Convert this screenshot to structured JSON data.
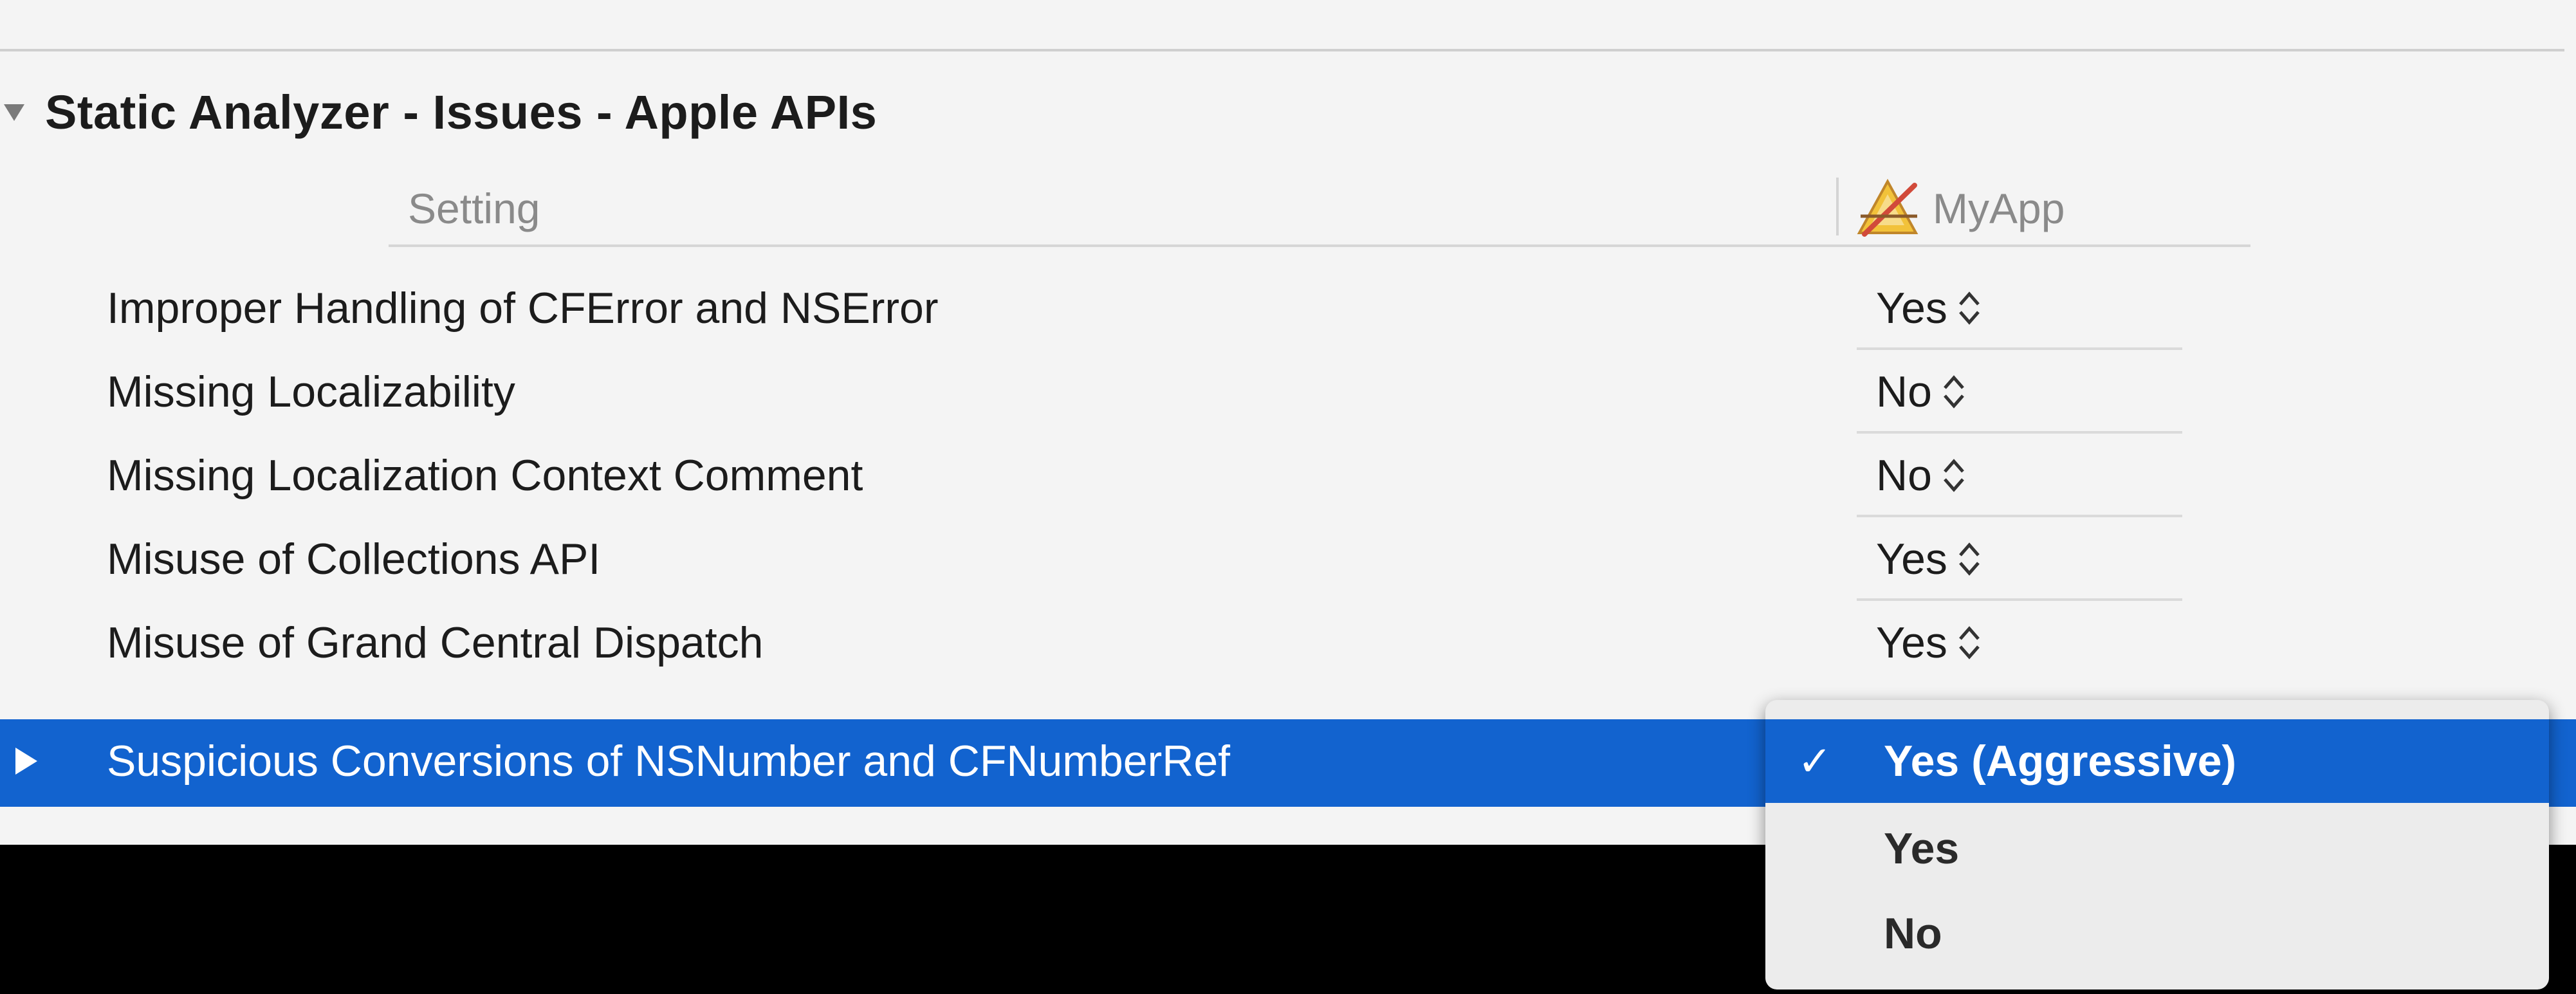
{
  "section": {
    "title": "Static Analyzer - Issues - Apple APIs",
    "disclosure_icon": "disclosure-triangle-down-icon"
  },
  "columns": {
    "setting_header": "Setting",
    "target_header": "MyApp",
    "target_icon": "app-target-icon"
  },
  "rows": [
    {
      "label": "Improper Handling of CFError and NSError",
      "value": "Yes"
    },
    {
      "label": "Missing Localizability",
      "value": "No"
    },
    {
      "label": "Missing Localization Context Comment",
      "value": "No"
    },
    {
      "label": "Misuse of Collections API",
      "value": "Yes"
    },
    {
      "label": "Misuse of Grand Central Dispatch",
      "value": "Yes"
    }
  ],
  "selected_row": {
    "label": "Suspicious Conversions of NSNumber and CFNumberRef",
    "disclosure_icon": "disclosure-triangle-right-icon"
  },
  "dropdown": {
    "options": [
      {
        "label": "Yes (Aggressive)",
        "checked": true
      },
      {
        "label": "Yes",
        "checked": false
      },
      {
        "label": "No",
        "checked": false
      }
    ],
    "check_mark": "✓"
  },
  "colors": {
    "selection": "#1263cf",
    "panel_background": "#f4f4f4",
    "window_background": "#000000"
  }
}
